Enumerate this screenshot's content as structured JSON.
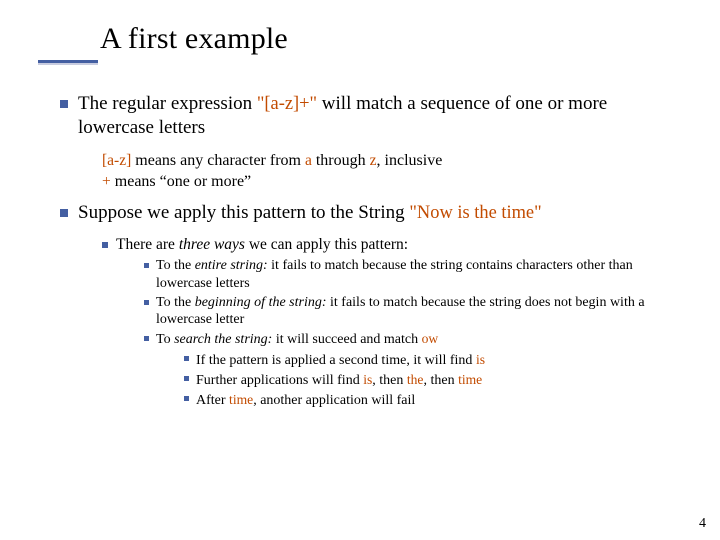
{
  "title": "A first example",
  "p1_a": "The regular expression ",
  "p1_code": "\"[a-z]+\"",
  "p1_b": " will match a sequence of one or more lowercase letters",
  "sub1_code1": "[a-z]",
  "sub1_text1": " means any character from ",
  "sub1_code2": "a",
  "sub1_text2": " through ",
  "sub1_code3": "z",
  "sub1_text3": ", inclusive",
  "sub2_code1": "+",
  "sub2_text1": " means “one or more”",
  "p2_a": "Suppose we apply this pattern to the String ",
  "p2_code": "\"Now is the time\"",
  "p3_a": "There are ",
  "p3_it": "three ways",
  "p3_b": " we can apply this pattern:",
  "entire_a": "To the ",
  "entire_it": "entire string:",
  "entire_b": " it fails to match because the string contains characters other than lowercase letters",
  "begin_a": "To the ",
  "begin_it": "beginning of the string:",
  "begin_b": " it fails to match because the string does not begin with a lowercase letter",
  "search_a": "To ",
  "search_it": "search the string:",
  "search_b": " it will succeed and match ",
  "search_code": "ow",
  "find_is_a": "If the pattern is applied a second time, it will find ",
  "find_is_code": "is",
  "further_a": "Further applications will find ",
  "further_c1": "is",
  "further_b": ", then ",
  "further_c2": "the",
  "further_c": ", then ",
  "further_c3": "time",
  "after_a": "After ",
  "after_code": "time",
  "after_b": ", another application will fail",
  "slidenum": "4"
}
